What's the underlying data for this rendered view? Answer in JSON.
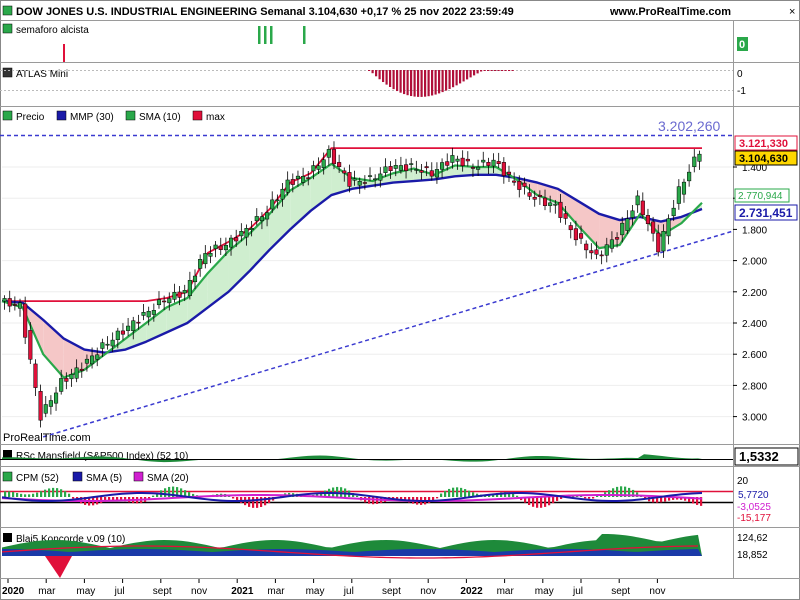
{
  "header": {
    "title": "DOW JONES U.S. INDUSTRIAL ENGINEERING Semanal 3.104,630 +0,17 % 25 nov 2022 23:59:49",
    "website": "www.ProRealTime.com",
    "watermark": "ProRealTime.com"
  },
  "panels": {
    "semaforo": {
      "label": "semaforo alcista",
      "value_label": "0"
    },
    "atlas": {
      "label": "ATLAS Mini",
      "ticks": [
        "0",
        "-1"
      ]
    },
    "price": {
      "legend": [
        {
          "label": "Precio",
          "color": "#2aa84a"
        },
        {
          "label": "MMP (30)",
          "color": "#1a1aa8"
        },
        {
          "label": "SMA (10)",
          "color": "#2aa84a"
        },
        {
          "label": "max",
          "color": "#e0103a"
        }
      ],
      "dashed_level_label": "3.202,260",
      "badges": {
        "max": "3.121,330",
        "last": "3.104,630",
        "sma10": "2.770,944",
        "mmp30": "2.731,451"
      },
      "y_ticks": [
        "3.000",
        "2.800",
        "2.600",
        "2.400",
        "2.200",
        "2.000",
        "1.800",
        "1.600",
        "1.400"
      ]
    },
    "rsc": {
      "label": "RSc Mansfield (S&P500 Index) (52 10)",
      "value": "1,5332"
    },
    "cpm": {
      "legend": [
        {
          "label": "CPM (52)",
          "color": "#2aa84a"
        },
        {
          "label": "SMA (5)",
          "color": "#1a1aa8"
        },
        {
          "label": "SMA (20)",
          "color": "#d020d0"
        }
      ],
      "ticks": [
        "20",
        "5,7720",
        "-3,0525",
        "-15,177"
      ]
    },
    "koncorde": {
      "label": "Blai5 Koncorde v.09 (10)",
      "ticks": [
        "124,62",
        "18,852"
      ]
    }
  },
  "x_axis": [
    "2020",
    "mar",
    "may",
    "jul",
    "sept",
    "nov",
    "2021",
    "mar",
    "may",
    "jul",
    "sept",
    "nov",
    "2022",
    "mar",
    "may",
    "jul",
    "sept",
    "nov"
  ],
  "x_axis_bold": [
    "2020",
    "2021",
    "2022"
  ],
  "chart_data": {
    "type": "line",
    "title": "DOW JONES U.S. INDUSTRIAL ENGINEERING Semanal",
    "x": [
      "2020-01",
      "2020-02",
      "2020-03",
      "2020-04",
      "2020-05",
      "2020-06",
      "2020-07",
      "2020-08",
      "2020-09",
      "2020-10",
      "2020-11",
      "2020-12",
      "2021-01",
      "2021-02",
      "2021-03",
      "2021-04",
      "2021-05",
      "2021-06",
      "2021-07",
      "2021-08",
      "2021-09",
      "2021-10",
      "2021-11",
      "2021-12",
      "2022-01",
      "2022-02",
      "2022-03",
      "2022-04",
      "2022-05",
      "2022-06",
      "2022-07",
      "2022-08",
      "2022-09",
      "2022-10",
      "2022-11"
    ],
    "series": [
      {
        "name": "Precio",
        "values": [
          2140,
          2110,
          1400,
          1620,
          1720,
          1850,
          1950,
          2050,
          2150,
          2200,
          2450,
          2500,
          2600,
          2720,
          2900,
          2950,
          3090,
          2900,
          2920,
          3000,
          3000,
          2960,
          3060,
          3000,
          3040,
          2900,
          2800,
          2750,
          2550,
          2420,
          2560,
          2790,
          2480,
          2850,
          3104
        ]
      },
      {
        "name": "MMP (30)",
        "values": [
          2140,
          2130,
          2020,
          1900,
          1830,
          1810,
          1830,
          1880,
          1940,
          2000,
          2100,
          2200,
          2330,
          2470,
          2600,
          2720,
          2820,
          2860,
          2880,
          2900,
          2910,
          2920,
          2940,
          2950,
          2950,
          2930,
          2900,
          2860,
          2780,
          2700,
          2660,
          2680,
          2650,
          2680,
          2731
        ]
      },
      {
        "name": "SMA (10)",
        "values": [
          2140,
          2100,
          1800,
          1650,
          1700,
          1800,
          1900,
          2000,
          2100,
          2160,
          2320,
          2460,
          2570,
          2700,
          2850,
          2930,
          3020,
          2930,
          2910,
          2960,
          2990,
          2950,
          3010,
          3000,
          3000,
          2920,
          2820,
          2770,
          2620,
          2480,
          2500,
          2700,
          2560,
          2640,
          2771
        ]
      },
      {
        "name": "max",
        "values": [
          2140,
          2140,
          2140,
          2140,
          2140,
          2140,
          2140,
          2140,
          2160,
          2200,
          2450,
          2520,
          2600,
          2730,
          2900,
          2960,
          3121,
          3121,
          3121,
          3121,
          3121,
          3121,
          3121,
          3121,
          3121,
          3121,
          3121,
          3121,
          3121,
          3121,
          3121,
          3121,
          3121,
          3121,
          3121
        ]
      }
    ],
    "ylim": [
      1250,
      3250
    ],
    "y_ticks": [
      1400,
      1600,
      1800,
      2000,
      2200,
      2400,
      2600,
      2800,
      3000
    ],
    "trendline": {
      "x": [
        "2020-03",
        "2022-11"
      ],
      "y": [
        1270,
        2530
      ]
    },
    "dashed_level": 3202.26,
    "annotations": [
      "3.202,260",
      "3.121,330",
      "3.104,630",
      "2.770,944",
      "2.731,451"
    ]
  },
  "colors": {
    "up": "#2aa84a",
    "down": "#e0103a",
    "mmp": "#1a1aa8",
    "sma": "#2aa84a",
    "max": "#e0103a",
    "dash": "#3a3ad0",
    "atlas_bar": "#b0103a",
    "cpm_sma20": "#d020d0",
    "koncorde_green": "#1e8a3a",
    "koncorde_blue": "#1a3aa8"
  }
}
